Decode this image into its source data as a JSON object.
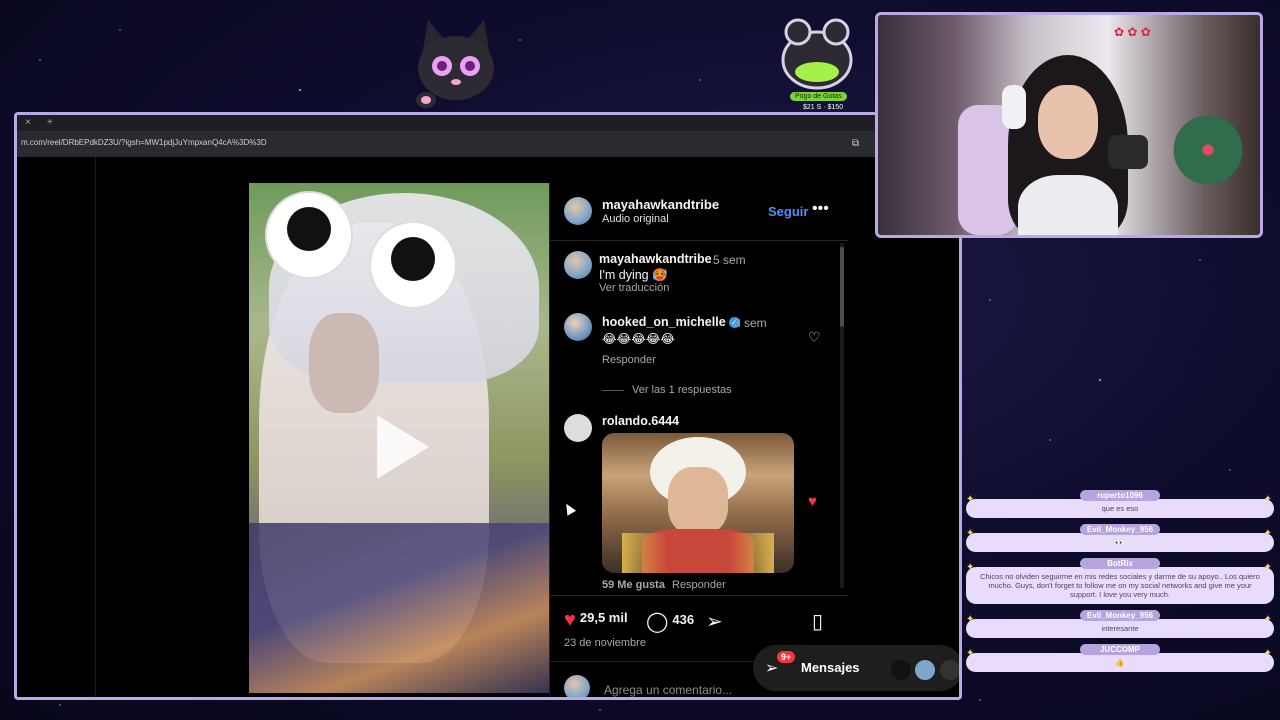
{
  "overlay": {
    "goal_label": "Pogo de Gotas",
    "goal_amount": "$21 S · $150"
  },
  "browser": {
    "url": "m.com/reel/DRbEPdkDZ3U/?igsh=MW1pdjJuYmpxanQ4cA%3D%3D"
  },
  "post": {
    "author": "mayahawkandtribe",
    "audio": "Audio original",
    "follow_label": "Seguir",
    "likes": "29,5 mil",
    "comments_count": "436",
    "date": "23 de noviembre",
    "add_comment_placeholder": "Agrega un comentario..."
  },
  "comments": [
    {
      "user": "mayahawkandtribe",
      "time": "5 sem",
      "text": "I'm dying 🥵",
      "sub": "Ver traducción"
    },
    {
      "user": "hooked_on_michelle",
      "time": "3 sem",
      "text": "😂😂😂😂😂",
      "sub": "Responder",
      "view_replies": "Ver las 1 respuestas"
    },
    {
      "user": "rolando.6444",
      "likes": "59 Me gusta",
      "sub": "Responder"
    }
  ],
  "messages": {
    "label": "Mensajes",
    "badge": "9+"
  },
  "chat": [
    {
      "user": "ruperto1096",
      "text": "que es eso"
    },
    {
      "user": "Evil_Monkey_956",
      "text": "👀"
    },
    {
      "user": "BotRix",
      "text": "Chicos no olviden seguirme en mis redes sociales y darme de su apoyo.. Los quiero mucho. Guys, don't forget to follow me on my social networks and give me your support. I love you very much."
    },
    {
      "user": "Evil_Monkey_956",
      "text": "interesante"
    },
    {
      "user": "JUCCOMP",
      "text": "👍"
    }
  ]
}
